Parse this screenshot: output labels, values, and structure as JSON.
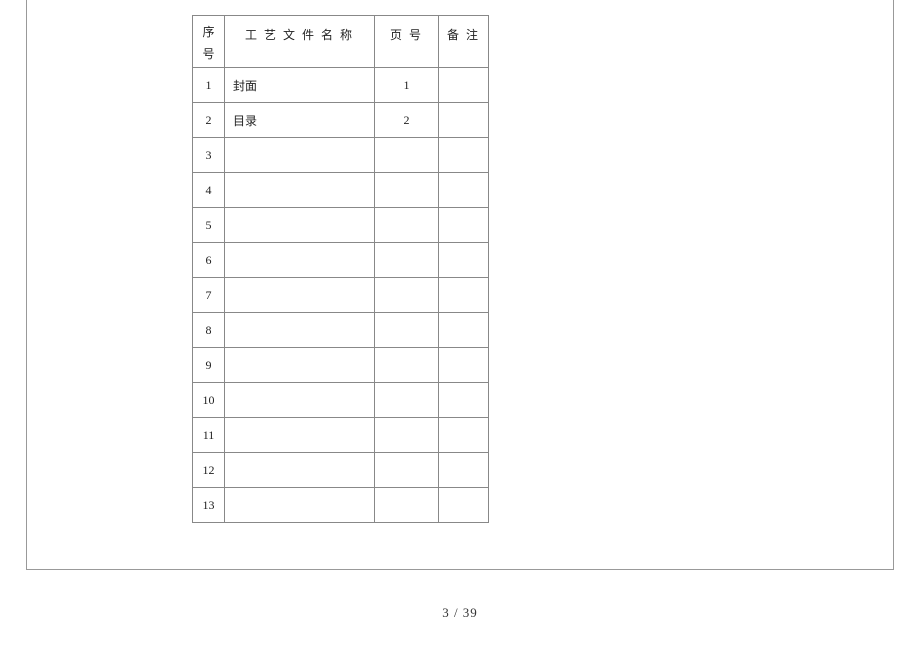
{
  "table": {
    "headers": {
      "seq": "序号",
      "name": "工 艺 文 件 名 称",
      "page": "页    号",
      "note": "备  注"
    },
    "rows": [
      {
        "seq": "1",
        "name": "封面",
        "page": "1",
        "note": ""
      },
      {
        "seq": "2",
        "name": "目录",
        "page": "2",
        "note": ""
      },
      {
        "seq": "3",
        "name": "",
        "page": "",
        "note": ""
      },
      {
        "seq": "4",
        "name": "",
        "page": "",
        "note": ""
      },
      {
        "seq": "5",
        "name": "",
        "page": "",
        "note": ""
      },
      {
        "seq": "6",
        "name": "",
        "page": "",
        "note": ""
      },
      {
        "seq": "7",
        "name": "",
        "page": "",
        "note": ""
      },
      {
        "seq": "8",
        "name": "",
        "page": "",
        "note": ""
      },
      {
        "seq": "9",
        "name": "",
        "page": "",
        "note": ""
      },
      {
        "seq": "10",
        "name": "",
        "page": "",
        "note": ""
      },
      {
        "seq": "11",
        "name": "",
        "page": "",
        "note": ""
      },
      {
        "seq": "12",
        "name": "",
        "page": "",
        "note": ""
      },
      {
        "seq": "13",
        "name": "",
        "page": "",
        "note": ""
      }
    ]
  },
  "footer": {
    "page_indicator": "3  / 39"
  }
}
